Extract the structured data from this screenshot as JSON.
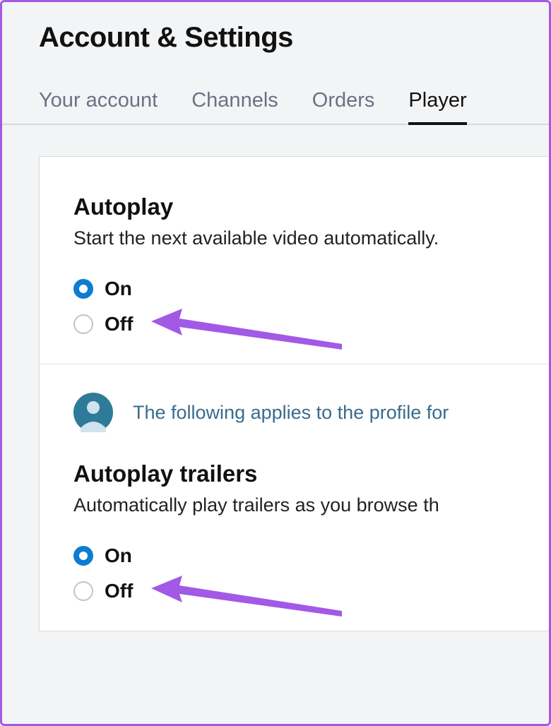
{
  "page_title": "Account & Settings",
  "tabs": {
    "your_account": "Your account",
    "channels": "Channels",
    "orders": "Orders",
    "player": "Player"
  },
  "autoplay": {
    "title": "Autoplay",
    "description": "Start the next available video automatically.",
    "on_label": "On",
    "off_label": "Off",
    "selected": "on"
  },
  "profile_banner": "The following applies to the profile for",
  "autoplay_trailers": {
    "title": "Autoplay trailers",
    "description": "Automatically play trailers as you browse th",
    "on_label": "On",
    "off_label": "Off",
    "selected": "on"
  },
  "colors": {
    "accent_blue": "#0d7dd1",
    "annotation_purple": "#a259e6",
    "avatar_teal": "#2e7a99"
  }
}
